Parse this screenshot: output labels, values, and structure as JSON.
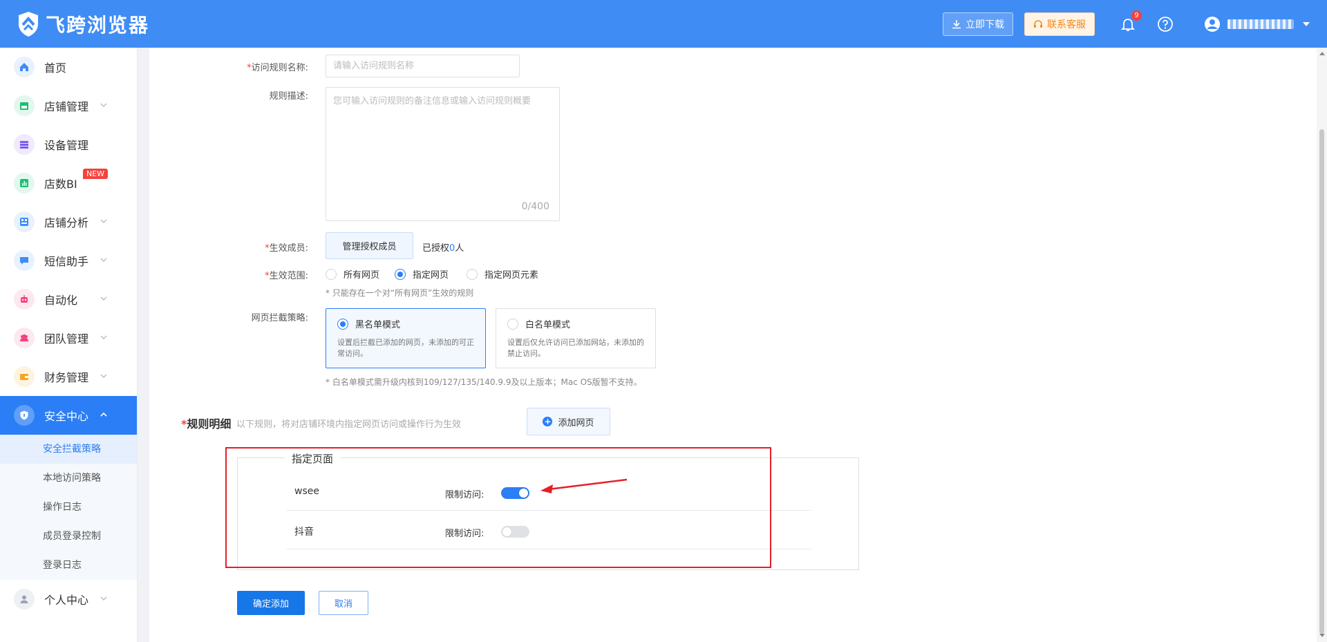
{
  "header": {
    "brand": "飞跨浏览器",
    "download_label": "立即下载",
    "support_label": "联系客服",
    "notification_count": "9",
    "user_name_visible": false
  },
  "sidebar": {
    "items": [
      {
        "label": "首页",
        "icon": "home-icon",
        "color": "#3f8cf5",
        "has_chevron": false
      },
      {
        "label": "店铺管理",
        "icon": "store-icon",
        "color": "#1cbf73",
        "has_chevron": true
      },
      {
        "label": "设备管理",
        "icon": "device-icon",
        "color": "#7a5cf0",
        "has_chevron": false
      },
      {
        "label": "店数BI",
        "icon": "chart-icon",
        "color": "#1cbf73",
        "has_chevron": false,
        "badge": "NEW"
      },
      {
        "label": "店铺分析",
        "icon": "analysis-icon",
        "color": "#3f8cf5",
        "has_chevron": true
      },
      {
        "label": "短信助手",
        "icon": "sms-icon",
        "color": "#3f8cf5",
        "has_chevron": true
      },
      {
        "label": "自动化",
        "icon": "robot-icon",
        "color": "#f5417a",
        "has_chevron": true
      },
      {
        "label": "团队管理",
        "icon": "team-icon",
        "color": "#f5417a",
        "has_chevron": true
      },
      {
        "label": "财务管理",
        "icon": "wallet-icon",
        "color": "#f5a524",
        "has_chevron": true
      },
      {
        "label": "安全中心",
        "icon": "shield-icon",
        "color": "#ffffff",
        "has_chevron": true,
        "active": true
      },
      {
        "label": "个人中心",
        "icon": "person-icon",
        "color": "#9aa3b2",
        "has_chevron": true
      }
    ],
    "security_sub_items": [
      {
        "label": "安全拦截策略",
        "active": true
      },
      {
        "label": "本地访问策略",
        "active": false
      },
      {
        "label": "操作日志",
        "active": false
      },
      {
        "label": "成员登录控制",
        "active": false
      },
      {
        "label": "登录日志",
        "active": false
      }
    ]
  },
  "form": {
    "rule_name_label": "访问规则名称:",
    "rule_name_placeholder": "请输入访问规则名称",
    "rule_desc_label": "规则描述:",
    "rule_desc_placeholder": "您可输入访问规则的备注信息或输入访问规则概要",
    "rule_desc_counter": "0/400",
    "members_label": "生效成员:",
    "members_button": "管理授权成员",
    "authorized_prefix": "已授权",
    "authorized_count": "0",
    "authorized_suffix": "人",
    "scope_label": "生效范围:",
    "scope_options": [
      {
        "label": "所有网页",
        "selected": false
      },
      {
        "label": "指定网页",
        "selected": true
      },
      {
        "label": "指定网页元素",
        "selected": false
      }
    ],
    "scope_hint": "* 只能存在一个对“所有网页”生效的规则",
    "strategy_label": "网页拦截策略:",
    "strategy_options": [
      {
        "title": "黑名单模式",
        "desc": "设置后拦截已添加的网页，未添加的可正常访问。",
        "selected": true
      },
      {
        "title": "白名单模式",
        "desc": "设置后仅允许访问已添加网站，未添加的禁止访问。",
        "selected": false
      }
    ],
    "strategy_hint": "* 白名单模式需升级内核到109/127/135/140.9.9及以上版本；Mac OS版暂不支持。"
  },
  "details": {
    "title": "规则明细",
    "desc": "以下规则，将对店铺环境内指定网页访问或操作行为生效",
    "add_button": "添加网页",
    "legend": "指定页面",
    "rows": [
      {
        "name": "wsee",
        "label": "限制访问:",
        "enabled": true
      },
      {
        "name": "抖音",
        "label": "限制访问:",
        "enabled": false
      }
    ]
  },
  "footer": {
    "confirm_label": "确定添加",
    "cancel_label": "取消"
  },
  "colors": {
    "header_bg": "#3f8cf5",
    "primary": "#2b7ef5",
    "highlight_red": "#e41f28"
  }
}
